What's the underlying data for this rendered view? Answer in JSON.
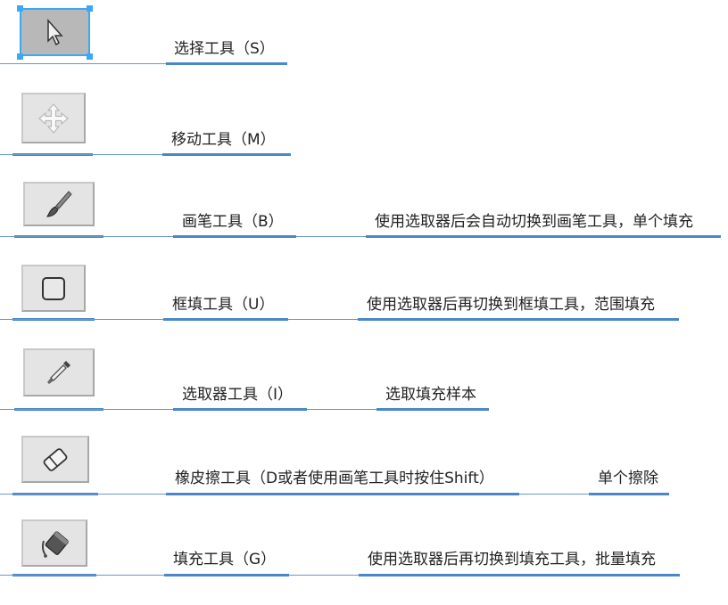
{
  "tools": [
    {
      "label": "选择工具（S）",
      "desc": "",
      "icon": "cursor-icon",
      "selected": true
    },
    {
      "label": "移动工具（M）",
      "desc": "",
      "icon": "move-arrows-icon"
    },
    {
      "label": "画笔工具（B）",
      "desc": "使用选取器后会自动切换到画笔工具，单个填充",
      "icon": "brush-icon"
    },
    {
      "label": "框填工具（U）",
      "desc": "使用选取器后再切换到框填工具，范围填充",
      "icon": "rectangle-icon"
    },
    {
      "label": "选取器工具（I）",
      "desc": "选取填充样本",
      "icon": "eyedropper-icon"
    },
    {
      "label": "橡皮擦工具（D或者使用画笔工具时按住Shift）",
      "desc": "单个擦除",
      "icon": "eraser-icon"
    },
    {
      "label": "填充工具（G）",
      "desc": "使用选取器后再切换到填充工具，批量填充",
      "icon": "paint-bucket-icon"
    }
  ],
  "colors": {
    "connector": "#4a86c8",
    "selection": "#3aa8f5"
  }
}
